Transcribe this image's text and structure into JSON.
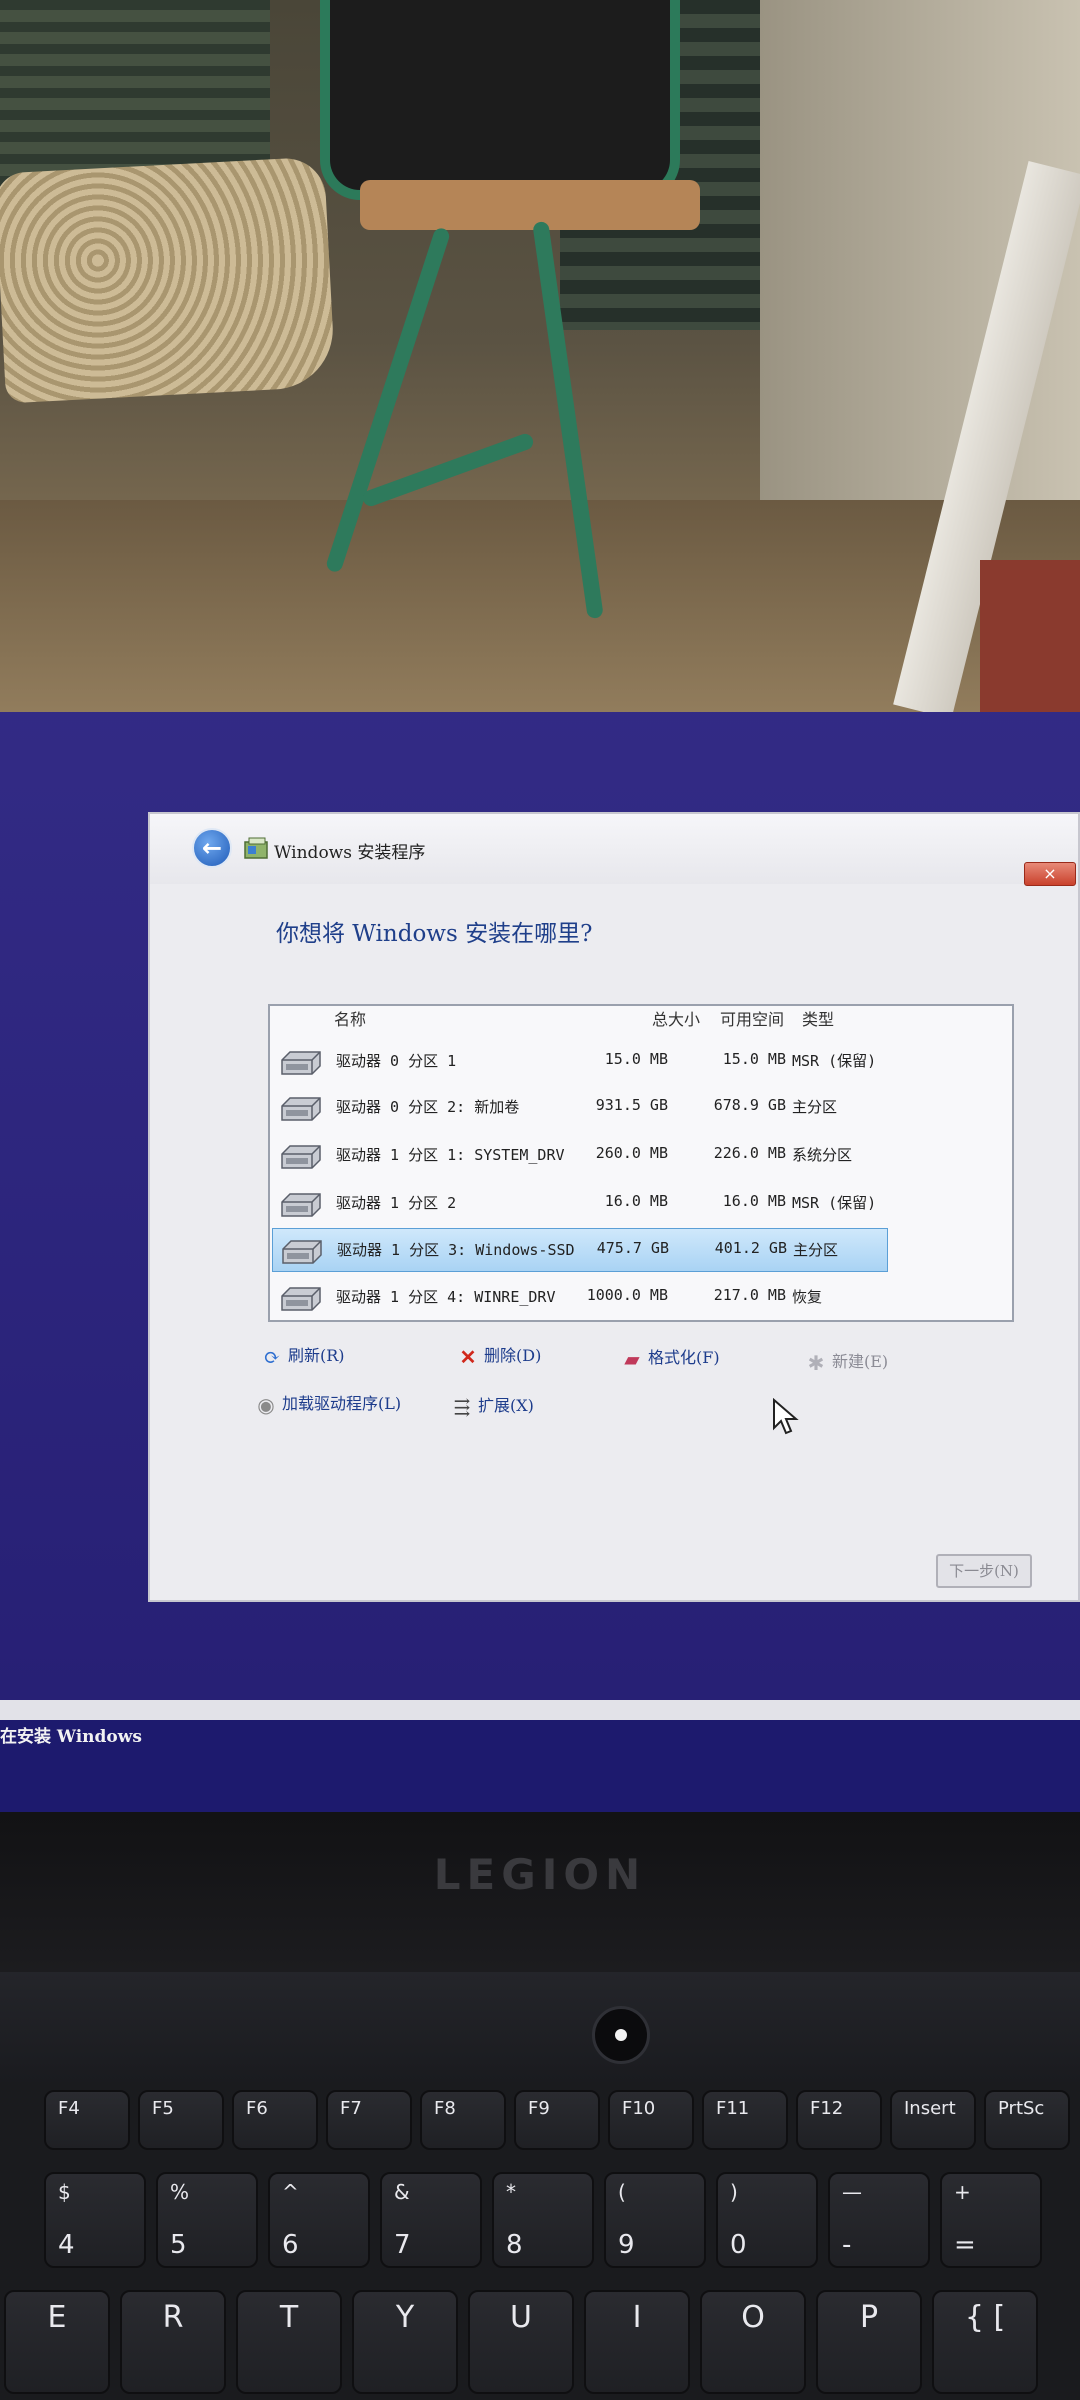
{
  "dialog": {
    "title": "Windows 安装程序",
    "question": "你想将 Windows 安装在哪里?",
    "close_label": "×",
    "back_label": "←",
    "columns": {
      "name": "名称",
      "total": "总大小",
      "free": "可用空间",
      "type": "类型"
    },
    "partitions": [
      {
        "name": "驱动器 0 分区 1",
        "total": "15.0 MB",
        "free": "15.0 MB",
        "type": "MSR (保留)",
        "selected": false
      },
      {
        "name": "驱动器 0 分区 2: 新加卷",
        "total": "931.5 GB",
        "free": "678.9 GB",
        "type": "主分区",
        "selected": false
      },
      {
        "name": "驱动器 1 分区 1: SYSTEM_DRV",
        "total": "260.0 MB",
        "free": "226.0 MB",
        "type": "系统分区",
        "selected": false
      },
      {
        "name": "驱动器 1 分区 2",
        "total": "16.0 MB",
        "free": "16.0 MB",
        "type": "MSR (保留)",
        "selected": false
      },
      {
        "name": "驱动器 1 分区 3: Windows-SSD",
        "total": "475.7 GB",
        "free": "401.2 GB",
        "type": "主分区",
        "selected": true
      },
      {
        "name": "驱动器 1 分区 4: WINRE_DRV",
        "total": "1000.0 MB",
        "free": "217.0 MB",
        "type": "恢复",
        "selected": false
      }
    ],
    "actions": {
      "refresh": "刷新(R)",
      "delete": "删除(D)",
      "format": "格式化(F)",
      "new": "新建(E)",
      "load_driver": "加载驱动程序(L)",
      "extend": "扩展(X)"
    },
    "next_label": "下一步(N)"
  },
  "status_text": "在安装 Windows",
  "laptop": {
    "brand": "LEGION"
  },
  "keyboard": {
    "fn_row": [
      "F4",
      "F5",
      "F6",
      "F7",
      "F8",
      "F9",
      "F10",
      "F11",
      "F12",
      "Insert",
      "PrtSc"
    ],
    "number_row": [
      {
        "top": "$",
        "bottom": "4"
      },
      {
        "top": "%",
        "bottom": "5"
      },
      {
        "top": "^",
        "bottom": "6"
      },
      {
        "top": "&",
        "bottom": "7"
      },
      {
        "top": "*",
        "bottom": "8"
      },
      {
        "top": "(",
        "bottom": "9"
      },
      {
        "top": ")",
        "bottom": "0"
      },
      {
        "top": "—",
        "bottom": "-"
      },
      {
        "top": "+",
        "bottom": "="
      }
    ],
    "letter_row": [
      "E",
      "R",
      "T",
      "Y",
      "U",
      "I",
      "O",
      "P",
      "{ ["
    ]
  },
  "colors": {
    "screen_bg": "#2a2280",
    "selection": "#a9d3f4",
    "link_text": "#1d3c8c"
  }
}
